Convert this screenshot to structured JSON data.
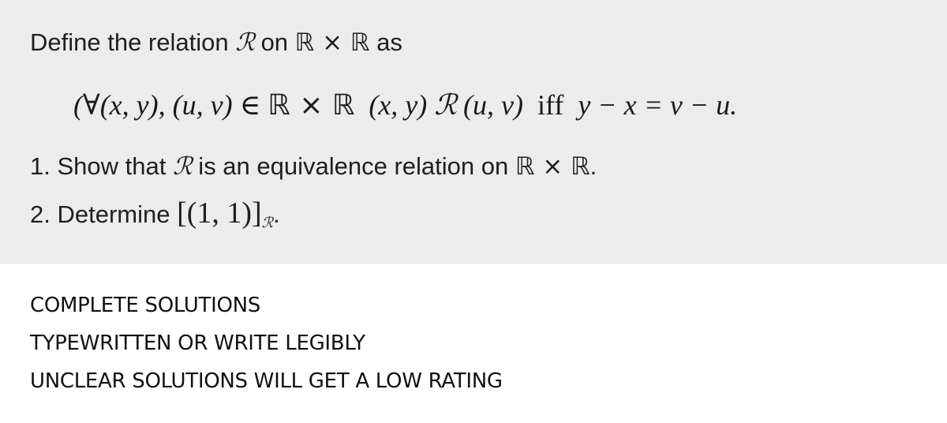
{
  "problem": {
    "intro": {
      "prefix": "Define the relation ",
      "relation_symbol": "ℛ",
      "middle": " on ",
      "set": "ℝ × ℝ",
      "suffix": " as"
    },
    "definition": {
      "quantifier": "(∀(x, y), (u, v) ∈ ",
      "set": "ℝ × ℝ",
      "left_pair": "  (x, y) ",
      "relation_symbol": "ℛ",
      "right_pair": " (u, v)  ",
      "iff": "iff",
      "condition": "  y − x = v − u."
    },
    "tasks": [
      {
        "prefix": "1. Show that ",
        "relation_symbol": "ℛ",
        "middle": " is an equivalence relation on ",
        "set": "ℝ × ℝ",
        "suffix": "."
      },
      {
        "prefix": "2. Determine ",
        "class_expr": "[(1, 1)]",
        "subscript": "ℛ",
        "suffix": "."
      }
    ]
  },
  "notes": [
    "COMPLETE SOLUTIONS",
    "TYPEWRITTEN OR WRITE LEGIBLY",
    "UNCLEAR SOLUTIONS WILL GET A LOW RATING"
  ],
  "colors": {
    "problem_background": "#ececec",
    "page_background": "#ffffff",
    "text": "#1f1f1f"
  }
}
